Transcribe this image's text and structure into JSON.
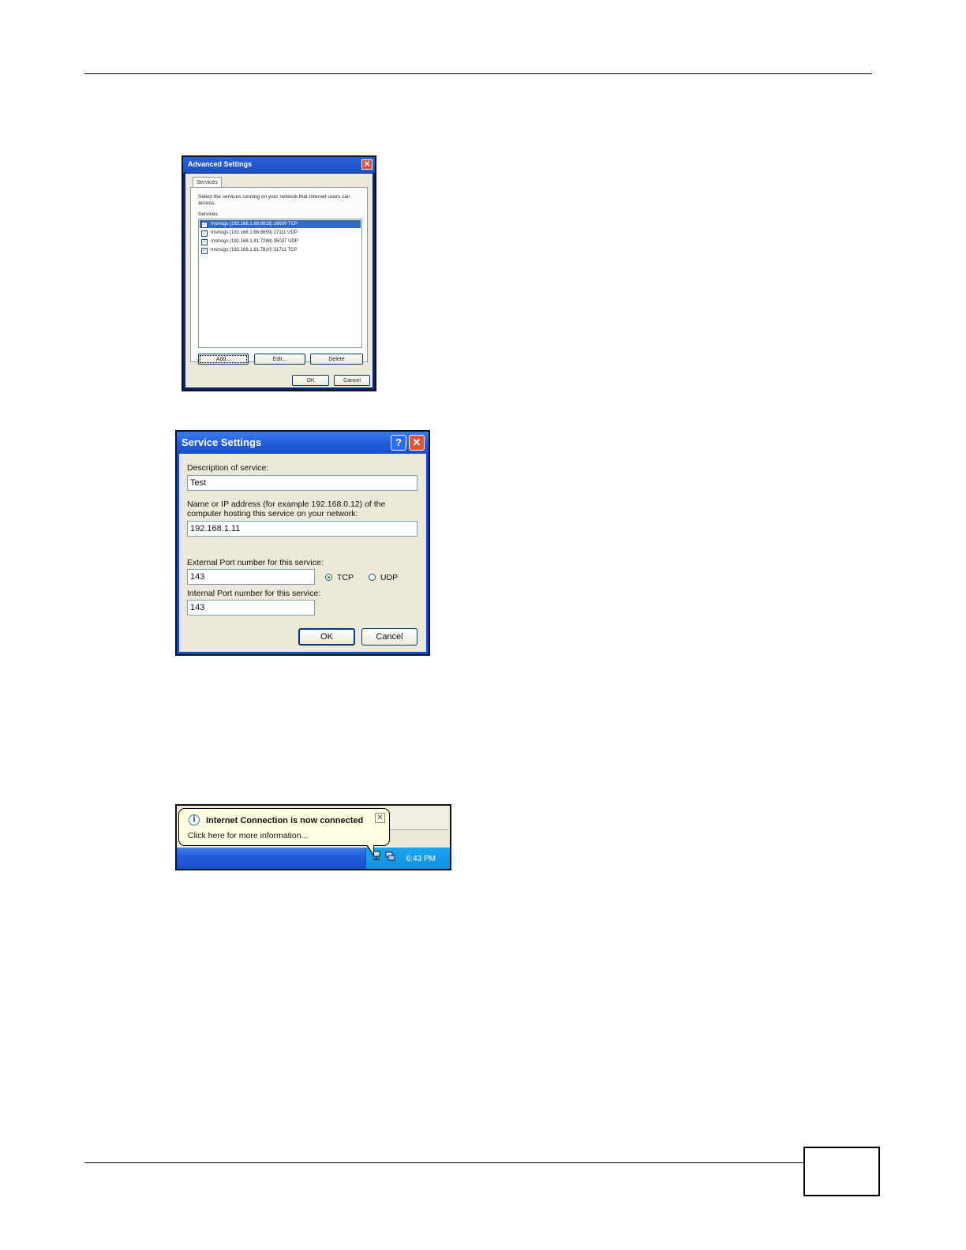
{
  "advanced_dialog": {
    "title": "Advanced Settings",
    "tab": "Services",
    "description": "Select the services running on your network that Internet users can access.",
    "services_label": "Services",
    "services": [
      {
        "label": "msmsgs (192.168.1.66:8618) 16609 TCP",
        "checked": true,
        "selected": true
      },
      {
        "label": "msmsgs (192.168.1.66:8659) 27111 UDP",
        "checked": true,
        "selected": false
      },
      {
        "label": "msmsgs (192.168.1.81:7288) 35037 UDP",
        "checked": true,
        "selected": false
      },
      {
        "label": "msmsgs (192.168.1.81:7810) 31711 TCP",
        "checked": true,
        "selected": false
      }
    ],
    "buttons": {
      "add": "Add...",
      "edit": "Edit...",
      "delete": "Delete",
      "ok": "OK",
      "cancel": "Cancel"
    }
  },
  "service_dialog": {
    "title": "Service Settings",
    "help_glyph": "?",
    "close_glyph": "✕",
    "description_label": "Description of service:",
    "description_value": "Test",
    "host_label_line1": "Name or IP address (for example 192.168.0.12) of the",
    "host_label_line2": "computer hosting this service on your network:",
    "host_value": "192.168.1.11",
    "external_label": "External Port number for this service:",
    "external_value": "143",
    "internal_label": "Internal Port number for this service:",
    "internal_value": "143",
    "protocols": [
      {
        "label": "TCP",
        "selected": true
      },
      {
        "label": "UDP",
        "selected": false
      }
    ],
    "buttons": {
      "ok": "OK",
      "cancel": "Cancel"
    }
  },
  "taskbar": {
    "balloon_title": "Internet Connection is now connected",
    "balloon_text": "Click here for more information...",
    "clock": "6:43 PM",
    "info_glyph": "i",
    "close_glyph": "✕"
  },
  "colors": {
    "titlebar_blue": "#245edb",
    "selection": "#316ac5",
    "balloon": "#ffffe1",
    "tray": "#1290dd"
  },
  "icons": [
    "close-icon",
    "help-icon",
    "info-icon",
    "network-icon"
  ]
}
